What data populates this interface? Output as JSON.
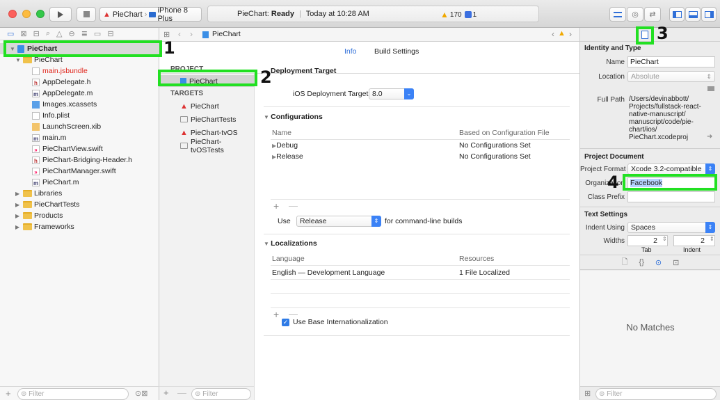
{
  "toolbar": {
    "scheme_target": "PieChart",
    "scheme_device": "iPhone 8 Plus",
    "status_project": "PieChart:",
    "status_state": "Ready",
    "status_time": "Today at 10:28 AM",
    "warning_count": "170",
    "error_count": "1"
  },
  "navigator": {
    "root": "PieChart",
    "items": [
      {
        "label": "PieChart",
        "type": "group"
      },
      {
        "label": "main.jsbundle",
        "type": "file-red"
      },
      {
        "label": "AppDelegate.h",
        "type": "h"
      },
      {
        "label": "AppDelegate.m",
        "type": "m"
      },
      {
        "label": "Images.xcassets",
        "type": "assets"
      },
      {
        "label": "Info.plist",
        "type": "plist"
      },
      {
        "label": "LaunchScreen.xib",
        "type": "xib"
      },
      {
        "label": "main.m",
        "type": "m"
      },
      {
        "label": "PieChartView.swift",
        "type": "swift"
      },
      {
        "label": "PieChart-Bridging-Header.h",
        "type": "h"
      },
      {
        "label": "PieChartManager.swift",
        "type": "swift"
      },
      {
        "label": "PieChart.m",
        "type": "m"
      },
      {
        "label": "Libraries",
        "type": "folder"
      },
      {
        "label": "PieChartTests",
        "type": "folder"
      },
      {
        "label": "Products",
        "type": "folder"
      },
      {
        "label": "Frameworks",
        "type": "folder"
      }
    ],
    "filter_placeholder": "Filter"
  },
  "editor": {
    "breadcrumb": "PieChart",
    "tabs": [
      "Info",
      "Build Settings"
    ],
    "project_header": "PROJECT",
    "project_item": "PieChart",
    "targets_header": "TARGETS",
    "targets": [
      "PieChart",
      "PieChartTests",
      "PieChart-tvOS",
      "PieChart-tvOSTests"
    ],
    "filter_placeholder": "Filter",
    "deployment": {
      "title": "Deployment Target",
      "label": "iOS Deployment Target",
      "value": "8.0"
    },
    "configurations": {
      "title": "Configurations",
      "col_name": "Name",
      "col_based": "Based on Configuration File",
      "rows": [
        {
          "name": "Debug",
          "based": "No Configurations Set"
        },
        {
          "name": "Release",
          "based": "No Configurations Set"
        }
      ],
      "use_label": "Use",
      "use_value": "Release",
      "use_suffix": "for command-line builds"
    },
    "localizations": {
      "title": "Localizations",
      "col_language": "Language",
      "col_resources": "Resources",
      "rows": [
        {
          "language": "English — Development Language",
          "resources": "1 File Localized"
        }
      ],
      "checkbox_label": "Use Base Internationalization"
    }
  },
  "inspector": {
    "identity_title": "Identity and Type",
    "name_label": "Name",
    "name_value": "PieChart",
    "location_label": "Location",
    "location_value": "Absolute",
    "fullpath_label": "Full Path",
    "fullpath_value": "/Users/devinabbott/Projects/fullstack-react-native-manuscript/manuscript/code/pie-chart/ios/PieChart.xcodeproj",
    "fullpath_lines": [
      "/Users/devinabbott/",
      "Projects/fullstack-react-",
      "native-manuscript/",
      "manuscript/code/pie-",
      "chart/ios/",
      "PieChart.xcodeproj"
    ],
    "project_doc_title": "Project Document",
    "format_label": "Project Format",
    "format_value": "Xcode 3.2-compatible",
    "org_label": "Organization",
    "org_value": "Facebook",
    "prefix_label": "Class Prefix",
    "prefix_value": "",
    "text_settings_title": "Text Settings",
    "indent_label": "Indent Using",
    "indent_value": "Spaces",
    "widths_label": "Widths",
    "tab_value": "2",
    "indent_width_value": "2",
    "tab_caption": "Tab",
    "indent_caption": "Indent",
    "no_matches": "No Matches",
    "filter_placeholder": "Filter"
  },
  "annotations": [
    "1",
    "2",
    "3",
    "4"
  ],
  "colors": {
    "highlight": "#22e022",
    "accent": "#3b82f6",
    "red_file": "#e0251b"
  }
}
